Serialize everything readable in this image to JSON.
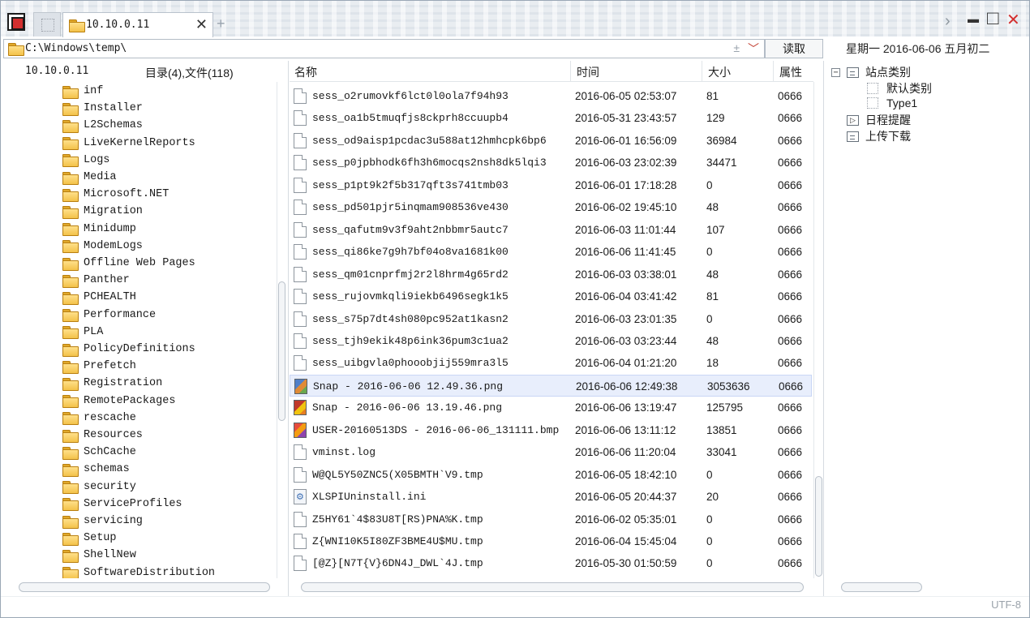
{
  "window": {
    "tab_label": "10.10.0.11",
    "tab_close": "✕",
    "tab_add": "+",
    "btn_next": "›",
    "btn_min": "▬",
    "btn_max": "□",
    "btn_close": "✕"
  },
  "address": {
    "path": "C:\\Windows\\temp\\",
    "up_glyph": "±",
    "dropdown_glyph": "﹀",
    "read_button": "读取"
  },
  "date_bar": "星期一  2016-06-06  五月初二",
  "left_panel": {
    "site": "10.10.0.11",
    "summary": "目录(4),文件(118)",
    "folders": [
      "inf",
      "Installer",
      "L2Schemas",
      "LiveKernelReports",
      "Logs",
      "Media",
      "Microsoft.NET",
      "Migration",
      "Minidump",
      "ModemLogs",
      "Offline Web Pages",
      "Panther",
      "PCHEALTH",
      "Performance",
      "PLA",
      "PolicyDefinitions",
      "Prefetch",
      "Registration",
      "RemotePackages",
      "rescache",
      "Resources",
      "SchCache",
      "schemas",
      "security",
      "ServiceProfiles",
      "servicing",
      "Setup",
      "ShellNew",
      "SoftwareDistribution"
    ]
  },
  "file_list": {
    "headers": {
      "name": "名称",
      "time": "时间",
      "size": "大小",
      "attr": "属性"
    },
    "rows": [
      {
        "name": "sess_o2rumovkf6lct0l0ola7f94h93",
        "time": "2016-06-05 02:53:07",
        "size": "81",
        "attr": "0666",
        "icon": "file-icon"
      },
      {
        "name": "sess_oa1b5tmuqfjs8ckprh8ccuupb4",
        "time": "2016-05-31 23:43:57",
        "size": "129",
        "attr": "0666",
        "icon": "file-icon"
      },
      {
        "name": "sess_od9aisp1pcdac3u588at12hmhcpk6bp6",
        "time": "2016-06-01 16:56:09",
        "size": "36984",
        "attr": "0666",
        "icon": "file-icon"
      },
      {
        "name": "sess_p0jpbhodk6fh3h6mocqs2nsh8dk5lqi3",
        "time": "2016-06-03 23:02:39",
        "size": "34471",
        "attr": "0666",
        "icon": "file-icon"
      },
      {
        "name": "sess_p1pt9k2f5b317qft3s741tmb03",
        "time": "2016-06-01 17:18:28",
        "size": "0",
        "attr": "0666",
        "icon": "file-icon"
      },
      {
        "name": "sess_pd501pjr5inqmam908536ve430",
        "time": "2016-06-02 19:45:10",
        "size": "48",
        "attr": "0666",
        "icon": "file-icon"
      },
      {
        "name": "sess_qafutm9v3f9aht2nbbmr5autc7",
        "time": "2016-06-03 11:01:44",
        "size": "107",
        "attr": "0666",
        "icon": "file-icon"
      },
      {
        "name": "sess_qi86ke7g9h7bf04o8va1681k00",
        "time": "2016-06-06 11:41:45",
        "size": "0",
        "attr": "0666",
        "icon": "file-icon"
      },
      {
        "name": "sess_qm01cnprfmj2r2l8hrm4g65rd2",
        "time": "2016-06-03 03:38:01",
        "size": "48",
        "attr": "0666",
        "icon": "file-icon"
      },
      {
        "name": "sess_rujovmkqli9iekb6496segk1k5",
        "time": "2016-06-04 03:41:42",
        "size": "81",
        "attr": "0666",
        "icon": "file-icon"
      },
      {
        "name": "sess_s75p7dt4sh080pc952at1kasn2",
        "time": "2016-06-03 23:01:35",
        "size": "0",
        "attr": "0666",
        "icon": "file-icon"
      },
      {
        "name": "sess_tjh9ekik48p6ink36pum3c1ua2",
        "time": "2016-06-03 03:23:44",
        "size": "48",
        "attr": "0666",
        "icon": "file-icon"
      },
      {
        "name": "sess_uibgvla0phooobjij559mra3l5",
        "time": "2016-06-04 01:21:20",
        "size": "18",
        "attr": "0666",
        "icon": "file-icon"
      },
      {
        "name": "Snap - 2016-06-06 12.49.36.png",
        "time": "2016-06-06 12:49:38",
        "size": "3053636",
        "attr": "0666",
        "icon": "png-icon",
        "selected": true
      },
      {
        "name": "Snap - 2016-06-06 13.19.46.png",
        "time": "2016-06-06 13:19:47",
        "size": "125795",
        "attr": "0666",
        "icon": "png2-icon"
      },
      {
        "name": "USER-20160513DS - 2016-06-06_131111.bmp",
        "time": "2016-06-06 13:11:12",
        "size": "13851",
        "attr": "0666",
        "icon": "bmp-icon"
      },
      {
        "name": "vminst.log",
        "time": "2016-06-06 11:20:04",
        "size": "33041",
        "attr": "0666",
        "icon": "file-icon"
      },
      {
        "name": "W@QL5Y50ZNC5(X05BMTH`V9.tmp",
        "time": "2016-06-05 18:42:10",
        "size": "0",
        "attr": "0666",
        "icon": "file-icon"
      },
      {
        "name": "XLSPIUninstall.ini",
        "time": "2016-06-05 20:44:37",
        "size": "20",
        "attr": "0666",
        "icon": "ini-icon"
      },
      {
        "name": "Z5HY61`4$83U8T[RS)PNA%K.tmp",
        "time": "2016-06-02 05:35:01",
        "size": "0",
        "attr": "0666",
        "icon": "file-icon"
      },
      {
        "name": "Z{WNI10K5I80ZF3BME4U$MU.tmp",
        "time": "2016-06-04 15:45:04",
        "size": "0",
        "attr": "0666",
        "icon": "file-icon"
      },
      {
        "name": "[@Z}[N7T{V}6DN4J_DWL`4J.tmp",
        "time": "2016-05-30 01:50:59",
        "size": "0",
        "attr": "0666",
        "icon": "file-icon"
      }
    ]
  },
  "right_panel": {
    "site_category": "站点类别",
    "default_category": "默认类别",
    "type1": "Type1",
    "schedule": "日程提醒",
    "transfer": "上传下载",
    "collapse_glyph": "−",
    "schedule_glyph": "▷"
  },
  "status": {
    "encoding": "UTF-8"
  }
}
